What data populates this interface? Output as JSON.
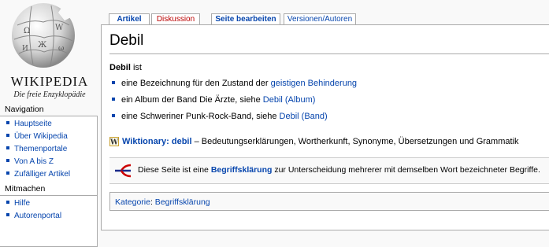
{
  "logo": {
    "wordmark": "WIKIPEDIA",
    "tagline": "Die freie Enzyklopädie",
    "icon": "wikipedia-globe-icon"
  },
  "tabs": {
    "article": "Artikel",
    "discussion": "Diskussion",
    "edit": "Seite bearbeiten",
    "history": "Versionen/Autoren"
  },
  "navigation": {
    "title": "Navigation",
    "items": [
      {
        "label": "Hauptseite"
      },
      {
        "label": "Über Wikipedia"
      },
      {
        "label": "Themenportale"
      },
      {
        "label": "Von A bis Z"
      },
      {
        "label": "Zufälliger Artikel"
      }
    ]
  },
  "mitmachen": {
    "title": "Mitmachen",
    "items": [
      {
        "label": "Hilfe"
      },
      {
        "label": "Autorenportal"
      }
    ]
  },
  "article": {
    "title": "Debil",
    "intro_bold": "Debil",
    "intro_rest": " ist",
    "meanings": [
      {
        "text": "eine Bezeichnung für den Zustand der ",
        "link": "geistigen Behinderung"
      },
      {
        "text": "ein Album der Band Die Ärzte, siehe ",
        "link": "Debil (Album)"
      },
      {
        "text": "eine Schweriner Punk-Rock-Band, siehe ",
        "link": "Debil (Band)"
      }
    ],
    "wiktionary": {
      "link": "Wiktionary: debil",
      "rest": " – Bedeutungserklärungen, Wortherkunft, Synonyme, Übersetzungen und Grammatik",
      "icon": "wiktionary-icon"
    },
    "disambig": {
      "prefix": "Diese Seite ist eine ",
      "link": "Begriffsklärung",
      "suffix": " zur Unterscheidung mehrerer mit demselben Wort bezeichneter Begriffe.",
      "icon": "disambiguation-icon"
    },
    "categories": {
      "label": "Kategorie",
      "separator": ": ",
      "item": "Begriffsklärung"
    }
  },
  "colors": {
    "link": "#0645ad",
    "new_link": "#ba0000",
    "border": "#aaaaaa",
    "background": "#f9f9f9"
  }
}
